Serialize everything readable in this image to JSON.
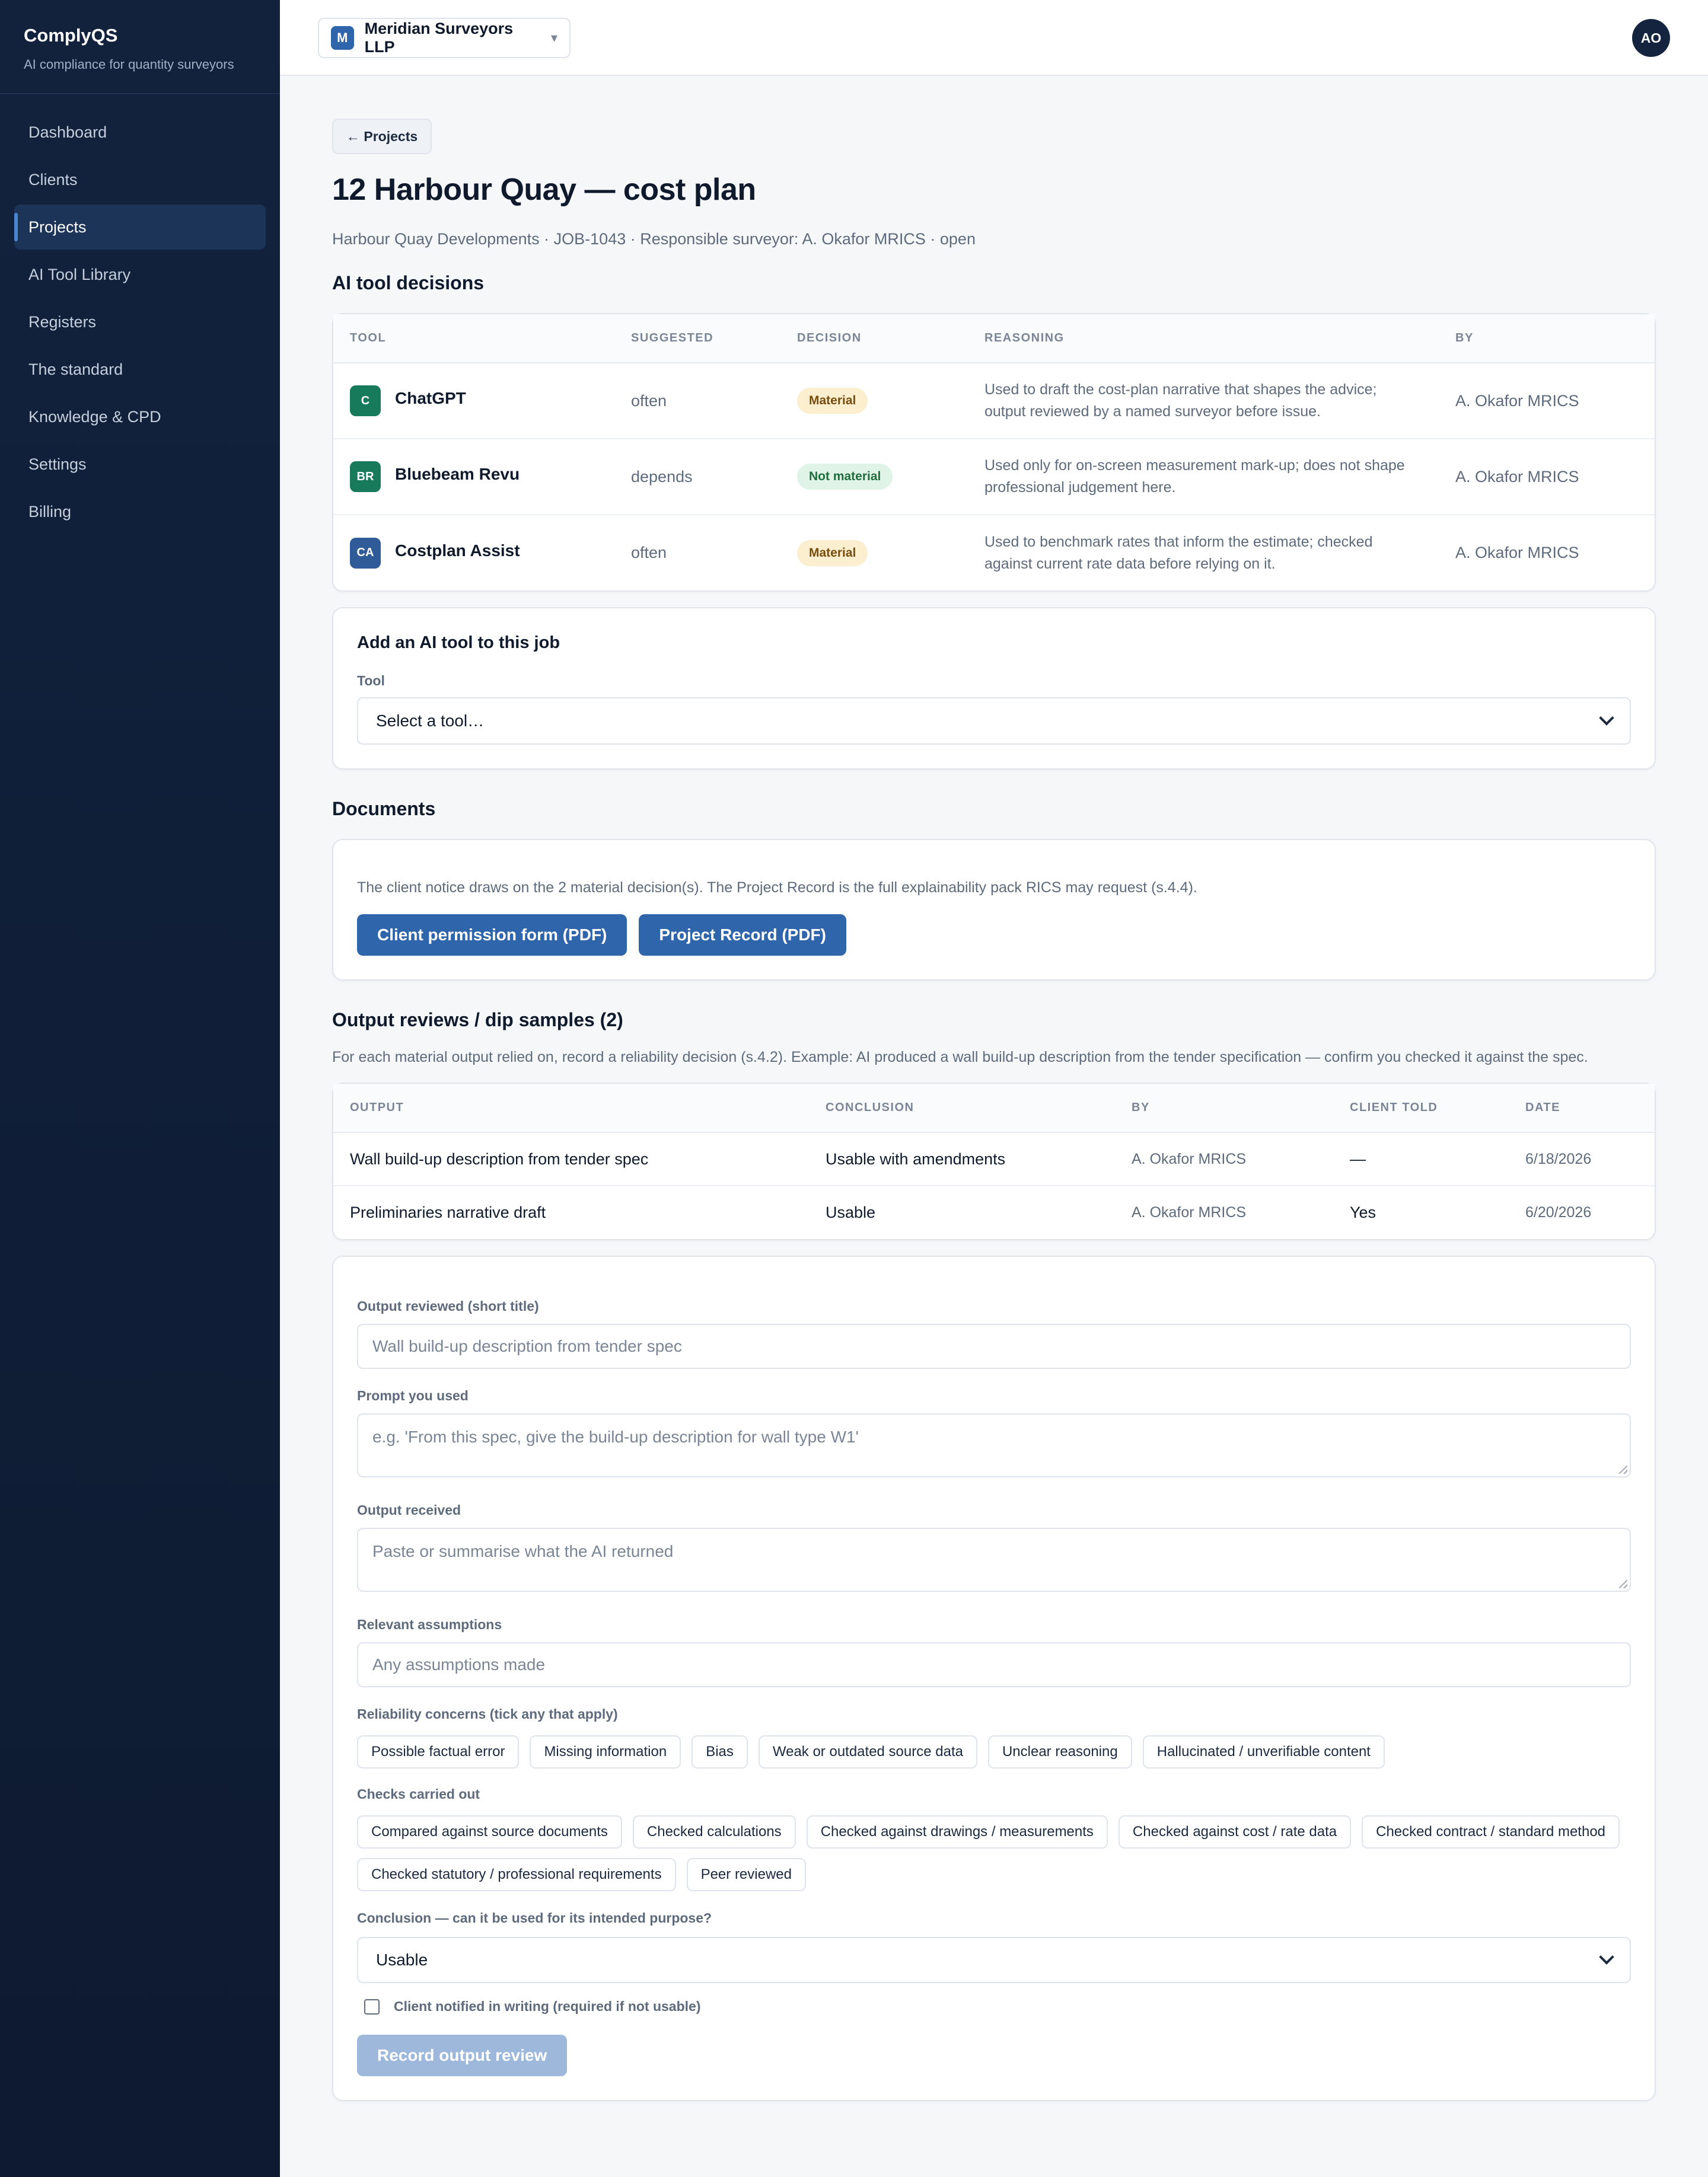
{
  "app": {
    "name": "ComplyQS",
    "tagline": "AI compliance for quantity surveyors"
  },
  "sidebar": {
    "items": [
      {
        "label": "Dashboard"
      },
      {
        "label": "Clients"
      },
      {
        "label": "Projects",
        "active": true
      },
      {
        "label": "AI Tool Library"
      },
      {
        "label": "Registers"
      },
      {
        "label": "The standard"
      },
      {
        "label": "Knowledge & CPD"
      },
      {
        "label": "Settings"
      },
      {
        "label": "Billing"
      }
    ]
  },
  "topbar": {
    "org_initial": "M",
    "org_name": "Meridian Surveyors LLP",
    "caret": "▾",
    "user_initials": "AO"
  },
  "page": {
    "back_label": "← Projects",
    "title": "12 Harbour Quay — cost plan",
    "subtitle": "Harbour Quay Developments · JOB-1043 · Responsible surveyor: A. Okafor MRICS · open"
  },
  "ai_decisions": {
    "title": "AI tool decisions",
    "headers": [
      "TOOL",
      "SUGGESTED",
      "DECISION",
      "REASONING",
      "BY"
    ],
    "rows": [
      {
        "initials": "C",
        "icon_color": "#177a5a",
        "tool": "ChatGPT",
        "suggested": "often",
        "decision": "Material",
        "decision_type": "material",
        "reasoning_1": "Used to draft the cost-plan narrative that shapes the advice;",
        "reasoning_2": "output reviewed by a named surveyor before issue.",
        "by": "A. Okafor MRICS"
      },
      {
        "initials": "BR",
        "icon_color": "#177a5a",
        "tool": "Bluebeam Revu",
        "suggested": "depends",
        "decision": "Not material",
        "decision_type": "notmaterial",
        "reasoning_1": "Used only for on-screen measurement mark-up; does not shape",
        "reasoning_2": "professional judgement here.",
        "by": "A. Okafor MRICS"
      },
      {
        "initials": "CA",
        "icon_color": "#2f5b99",
        "tool": "Costplan Assist",
        "suggested": "often",
        "decision": "Material",
        "decision_type": "material",
        "reasoning_1": "Used to benchmark rates that inform the estimate; checked",
        "reasoning_2": "against current rate data before relying on it.",
        "by": "A. Okafor MRICS"
      }
    ]
  },
  "add_tool": {
    "title": "Add an AI tool to this job",
    "field_label": "Tool",
    "select_value": "Select a tool…"
  },
  "documents": {
    "title": "Documents",
    "description": "The client notice draws on the 2 material decision(s). The Project Record is the full explainability pack RICS may request (s.4.4).",
    "btn_client": "Client permission form (PDF)",
    "btn_record": "Project Record (PDF)"
  },
  "reviews": {
    "title": "Output reviews / dip samples (2)",
    "description": "For each material output relied on, record a reliability decision (s.4.2). Example: AI produced a wall build-up description from the tender specification — confirm you checked it against the spec.",
    "headers": [
      "OUTPUT",
      "CONCLUSION",
      "BY",
      "CLIENT TOLD",
      "DATE"
    ],
    "rows": [
      {
        "output": "Wall build-up description from tender spec",
        "conclusion": "Usable with amendments",
        "by": "A. Okafor MRICS",
        "client_told": "—",
        "date": "6/18/2026"
      },
      {
        "output": "Preliminaries narrative draft",
        "conclusion": "Usable",
        "by": "A. Okafor MRICS",
        "client_told": "Yes",
        "date": "6/20/2026"
      }
    ]
  },
  "review_form": {
    "output_label": "Output reviewed (short title)",
    "output_placeholder": "Wall build-up description from tender spec",
    "prompt_label": "Prompt you used",
    "prompt_placeholder": "e.g. 'From this spec, give the build-up description for wall type W1'",
    "received_label": "Output received",
    "received_placeholder": "Paste or summarise what the AI returned",
    "assumptions_label": "Relevant assumptions",
    "assumptions_placeholder": "Any assumptions made",
    "concerns_label": "Reliability concerns (tick any that apply)",
    "concerns": [
      "Possible factual error",
      "Missing information",
      "Bias",
      "Weak or outdated source data",
      "Unclear reasoning",
      "Hallucinated / unverifiable content"
    ],
    "checks_label": "Checks carried out",
    "checks": [
      "Compared against source documents",
      "Checked calculations",
      "Checked against drawings / measurements",
      "Checked against cost / rate data",
      "Checked contract / standard method",
      "Checked statutory / professional requirements",
      "Peer reviewed"
    ],
    "conclusion_label": "Conclusion — can it be used for its intended purpose?",
    "conclusion_value": "Usable",
    "client_notified_label": "Client notified in writing (required if not usable)",
    "submit_label": "Record output review"
  }
}
